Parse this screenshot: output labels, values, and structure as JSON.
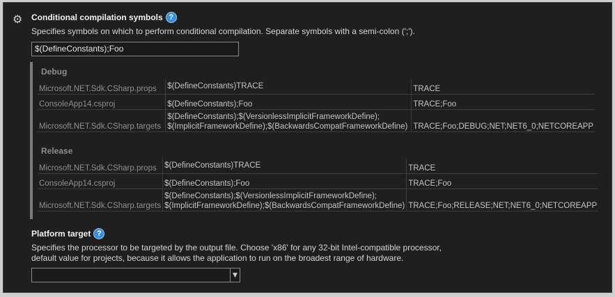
{
  "conditional": {
    "icon": "gear-icon",
    "title": "Conditional compilation symbols",
    "help": "?",
    "description": "Specifies symbols on which to perform conditional compilation. Separate symbols with a semi-colon (';').",
    "value": "$(DefineConstants);Foo"
  },
  "debug": {
    "label": "Debug",
    "rows": [
      {
        "source": "Microsoft.NET.Sdk.CSharp.props",
        "value1": "$(DefineConstants)TRACE",
        "value2": "",
        "result": "TRACE"
      },
      {
        "source": "ConsoleApp14.csproj",
        "value1": "$(DefineConstants);Foo",
        "value2": "",
        "result": "TRACE;Foo"
      },
      {
        "source": "Microsoft.NET.Sdk.CSharp.targets",
        "value1": "$(DefineConstants);$(VersionlessImplicitFrameworkDefine);",
        "value2": "$(ImplicitFrameworkDefine);$(BackwardsCompatFrameworkDefine)",
        "result": "TRACE;Foo;DEBUG;NET;NET6_0;NETCOREAPP"
      }
    ]
  },
  "release": {
    "label": "Release",
    "rows": [
      {
        "source": "Microsoft.NET.Sdk.CSharp.props",
        "value1": "$(DefineConstants)TRACE",
        "value2": "",
        "result": "TRACE"
      },
      {
        "source": "ConsoleApp14.csproj",
        "value1": "$(DefineConstants);Foo",
        "value2": "",
        "result": "TRACE;Foo"
      },
      {
        "source": "Microsoft.NET.Sdk.CSharp.targets",
        "value1": "$(DefineConstants);$(VersionlessImplicitFrameworkDefine);",
        "value2": "$(ImplicitFrameworkDefine);$(BackwardsCompatFrameworkDefine)",
        "result": "TRACE;Foo;RELEASE;NET;NET6_0;NETCOREAPP"
      }
    ]
  },
  "platform": {
    "title": "Platform target",
    "help": "?",
    "description_line1": "Specifies the processor to be targeted by the output file. Choose 'x86' for any 32-bit Intel-compatible processor,",
    "description_line2": "default value for projects, because it allows the application to run on the broadest range of hardware.",
    "selected": "",
    "dropdown_icon": "chevron-down-icon"
  },
  "colors": {
    "background": "#1f1f1f",
    "help_blue": "#3c8fd6",
    "text": "#d6d6d6"
  }
}
